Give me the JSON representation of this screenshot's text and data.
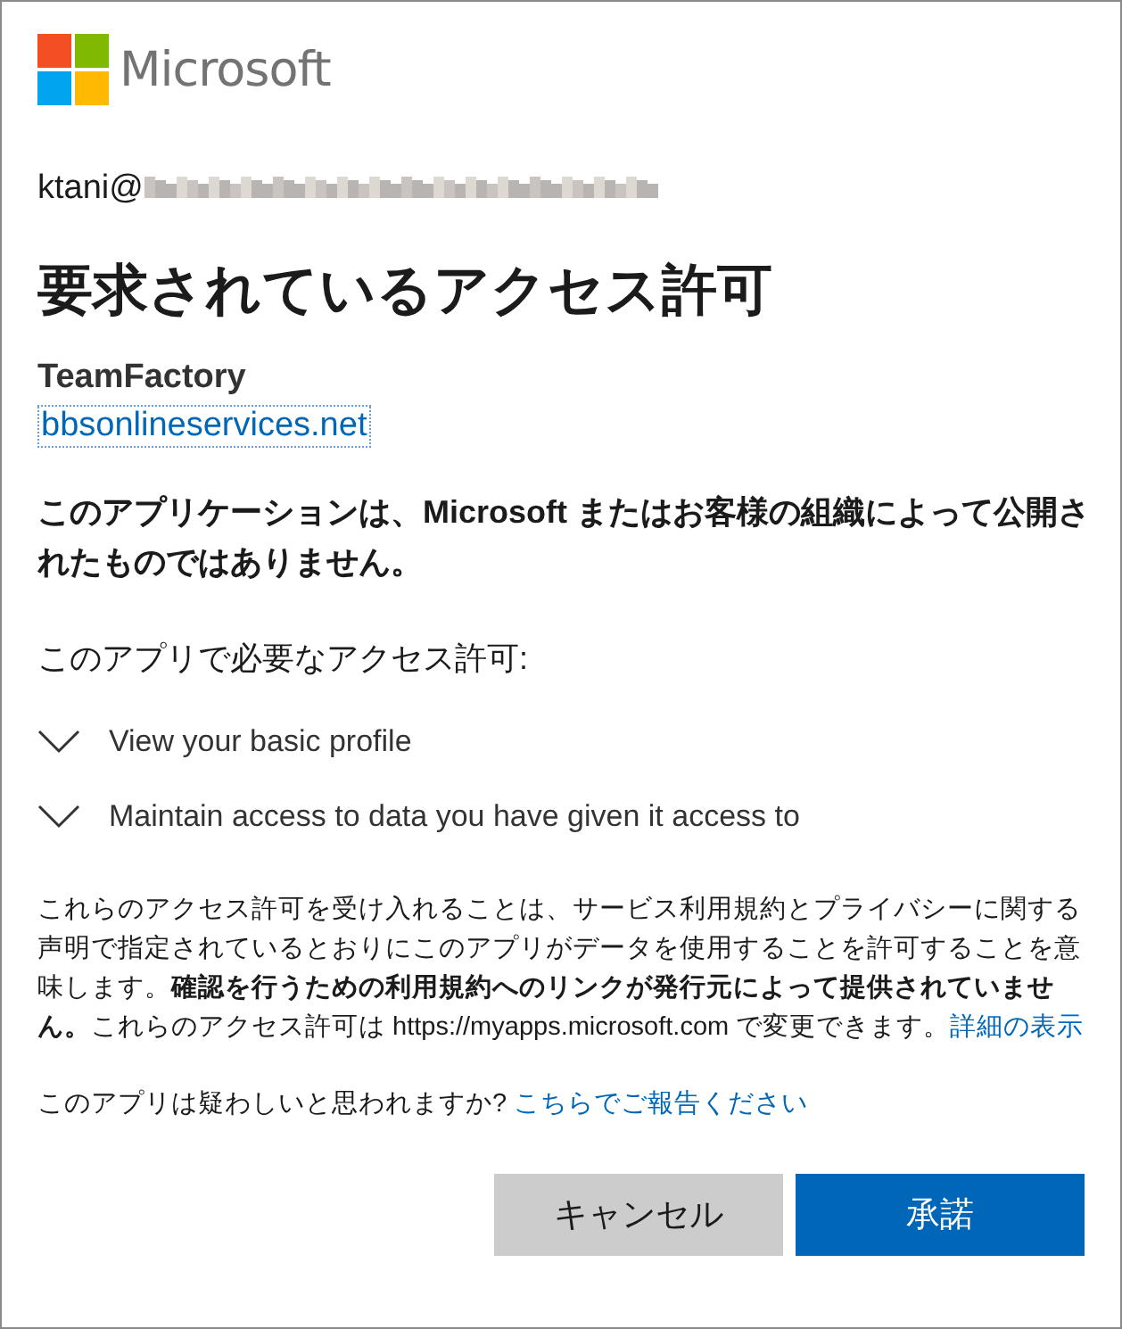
{
  "brand": {
    "name": "Microsoft"
  },
  "account": {
    "user": "ktani@"
  },
  "title": "要求されているアクセス許可",
  "app": {
    "name": "TeamFactory",
    "publisher_domain": "bbsonlineservices.net"
  },
  "warning": "このアプリケーションは、Microsoft またはお客様の組織によって公開されたものではありません。",
  "permissions_heading": "このアプリで必要なアクセス許可:",
  "permissions": [
    {
      "label": "View your basic profile",
      "expanded": false
    },
    {
      "label": "Maintain access to data you have given it access to",
      "expanded": false
    }
  ],
  "notice": {
    "text": "これらのアクセス許可を受け入れることは、サービス利用規約とプライバシーに関する声明で指定されているとおりにこのアプリがデータを使用することを許可することを意味します。**確認を行うための利用規約へのリンクが発行元によって提供されていません。**これらのアクセス許可は https://myapps.microsoft.com で変更できます。",
    "link": "詳細の表示"
  },
  "report": {
    "question": "このアプリは疑わしいと思われますか?",
    "link": "こちらでご報告ください"
  },
  "buttons": [
    {
      "label": "キャンセル",
      "kind": "secondary"
    },
    {
      "label": "承諾",
      "kind": "primary"
    }
  ]
}
